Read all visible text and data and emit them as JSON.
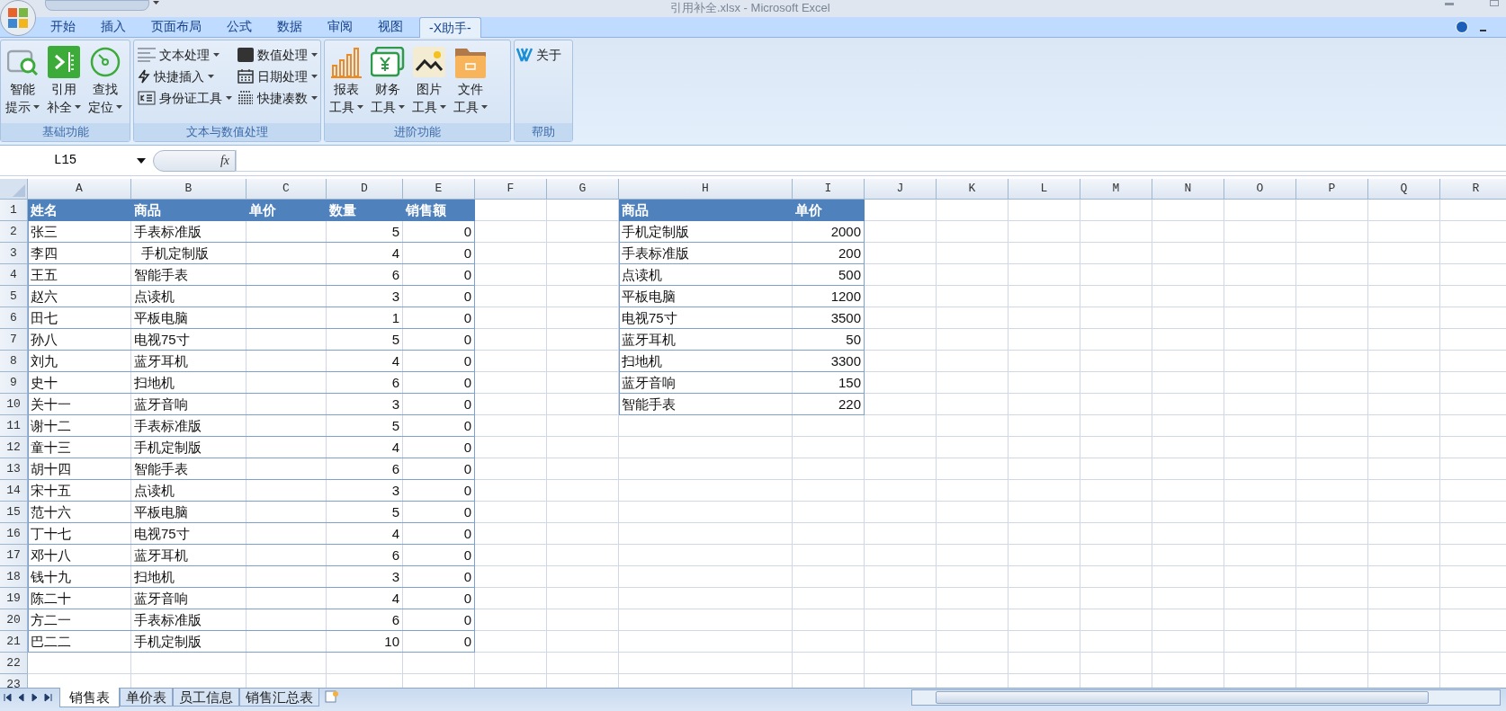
{
  "window": {
    "title": "引用补全.xlsx - Microsoft Excel"
  },
  "ribbon_tabs": [
    {
      "label": "开始",
      "selected": false
    },
    {
      "label": "插入",
      "selected": false
    },
    {
      "label": "页面布局",
      "selected": false
    },
    {
      "label": "公式",
      "selected": false
    },
    {
      "label": "数据",
      "selected": false
    },
    {
      "label": "审阅",
      "selected": false
    },
    {
      "label": "视图",
      "selected": false
    },
    {
      "label": "-X助手-",
      "selected": true
    }
  ],
  "ribbon_groups": [
    {
      "label": "基础功能",
      "buttons": [
        {
          "kind": "large",
          "lines": [
            "智能",
            "提示"
          ],
          "dropdown": true
        },
        {
          "kind": "large",
          "lines": [
            "引用",
            "补全"
          ],
          "dropdown": true
        },
        {
          "kind": "large",
          "lines": [
            "查找",
            "定位"
          ],
          "dropdown": true
        }
      ]
    },
    {
      "label": "文本与数值处理",
      "buttons": [
        {
          "kind": "small",
          "lines": [
            "文本处理"
          ],
          "dropdown": true
        },
        {
          "kind": "small",
          "lines": [
            "数值处理"
          ],
          "dropdown": true
        },
        {
          "kind": "small",
          "lines": [
            "快捷插入"
          ],
          "dropdown": true
        },
        {
          "kind": "small",
          "lines": [
            "日期处理"
          ],
          "dropdown": true
        },
        {
          "kind": "small",
          "lines": [
            "身份证工具"
          ],
          "dropdown": true
        },
        {
          "kind": "small",
          "lines": [
            "快捷凑数"
          ],
          "dropdown": true
        }
      ]
    },
    {
      "label": "进阶功能",
      "buttons": [
        {
          "kind": "large",
          "lines": [
            "报表",
            "工具"
          ],
          "dropdown": true
        },
        {
          "kind": "large",
          "lines": [
            "财务",
            "工具"
          ],
          "dropdown": true
        },
        {
          "kind": "large",
          "lines": [
            "图片",
            "工具"
          ],
          "dropdown": true
        },
        {
          "kind": "large",
          "lines": [
            "文件",
            "工具"
          ],
          "dropdown": true
        }
      ]
    },
    {
      "label": "帮助",
      "buttons": [
        {
          "kind": "small",
          "lines": [
            "关于"
          ],
          "dropdown": false
        }
      ]
    }
  ],
  "formula_bar": {
    "name_box": "L15",
    "function_label": "fx"
  },
  "sheet": {
    "columns": [
      "A",
      "B",
      "C",
      "D",
      "E",
      "F",
      "G",
      "H",
      "I",
      "J",
      "K",
      "L",
      "M",
      "N",
      "O",
      "P",
      "Q",
      "R"
    ],
    "rows": [
      {
        "number": "1",
        "kind": "header",
        "cells": [
          "姓名",
          "商品",
          "单价",
          "数量",
          "销售额",
          null,
          null,
          "商品",
          "单价"
        ]
      },
      {
        "number": "2",
        "kind": "data",
        "cells": [
          "张三",
          "手表标准版",
          null,
          "5",
          "0",
          null,
          null,
          "手机定制版",
          "2000"
        ]
      },
      {
        "number": "3",
        "kind": "data",
        "cells": [
          "李四",
          "  手机定制版",
          null,
          "4",
          "0",
          null,
          null,
          "手表标准版",
          "200"
        ]
      },
      {
        "number": "4",
        "kind": "data",
        "cells": [
          "王五",
          "智能手表",
          null,
          "6",
          "0",
          null,
          null,
          "点读机",
          "500"
        ]
      },
      {
        "number": "5",
        "kind": "data",
        "cells": [
          "赵六",
          "点读机",
          null,
          "3",
          "0",
          null,
          null,
          "平板电脑",
          "1200"
        ]
      },
      {
        "number": "6",
        "kind": "data",
        "cells": [
          "田七",
          "平板电脑",
          null,
          "1",
          "0",
          null,
          null,
          "电视75寸",
          "3500"
        ]
      },
      {
        "number": "7",
        "kind": "data",
        "cells": [
          "孙八",
          "电视75寸",
          null,
          "5",
          "0",
          null,
          null,
          "蓝牙耳机",
          "50"
        ]
      },
      {
        "number": "8",
        "kind": "data",
        "cells": [
          "刘九",
          "蓝牙耳机",
          null,
          "4",
          "0",
          null,
          null,
          "扫地机",
          "3300"
        ]
      },
      {
        "number": "9",
        "kind": "data",
        "cells": [
          "史十",
          "扫地机",
          null,
          "6",
          "0",
          null,
          null,
          "蓝牙音响",
          "150"
        ]
      },
      {
        "number": "10",
        "kind": "data",
        "cells": [
          "关十一",
          "蓝牙音响",
          null,
          "3",
          "0",
          null,
          null,
          "智能手表",
          "220"
        ]
      },
      {
        "number": "11",
        "kind": "data",
        "cells": [
          "谢十二",
          "手表标准版",
          null,
          "5",
          "0"
        ]
      },
      {
        "number": "12",
        "kind": "data",
        "cells": [
          "童十三",
          "手机定制版",
          null,
          "4",
          "0"
        ]
      },
      {
        "number": "13",
        "kind": "data",
        "cells": [
          "胡十四",
          "智能手表",
          null,
          "6",
          "0"
        ]
      },
      {
        "number": "14",
        "kind": "data",
        "cells": [
          "宋十五",
          "点读机",
          null,
          "3",
          "0"
        ]
      },
      {
        "number": "15",
        "kind": "data",
        "cells": [
          "范十六",
          "平板电脑",
          null,
          "5",
          "0"
        ]
      },
      {
        "number": "16",
        "kind": "data",
        "cells": [
          "丁十七",
          "电视75寸",
          null,
          "4",
          "0"
        ]
      },
      {
        "number": "17",
        "kind": "data",
        "cells": [
          "邓十八",
          "蓝牙耳机",
          null,
          "6",
          "0"
        ]
      },
      {
        "number": "18",
        "kind": "data",
        "cells": [
          "钱十九",
          "扫地机",
          null,
          "3",
          "0"
        ]
      },
      {
        "number": "19",
        "kind": "data",
        "cells": [
          "陈二十",
          "蓝牙音响",
          null,
          "4",
          "0"
        ]
      },
      {
        "number": "20",
        "kind": "data",
        "cells": [
          "方二一",
          "手表标准版",
          null,
          "6",
          "0"
        ]
      },
      {
        "number": "21",
        "kind": "data",
        "cells": [
          "巴二二",
          "手机定制版",
          null,
          "10",
          "0"
        ]
      },
      {
        "number": "22",
        "kind": "data",
        "cells": []
      },
      {
        "number": "23",
        "kind": "data",
        "cells": []
      }
    ]
  },
  "sheet_tabs": [
    {
      "label": "销售表",
      "selected": true
    },
    {
      "label": "单价表",
      "selected": false
    },
    {
      "label": "员工信息",
      "selected": false
    },
    {
      "label": "销售汇总表",
      "selected": false
    }
  ]
}
